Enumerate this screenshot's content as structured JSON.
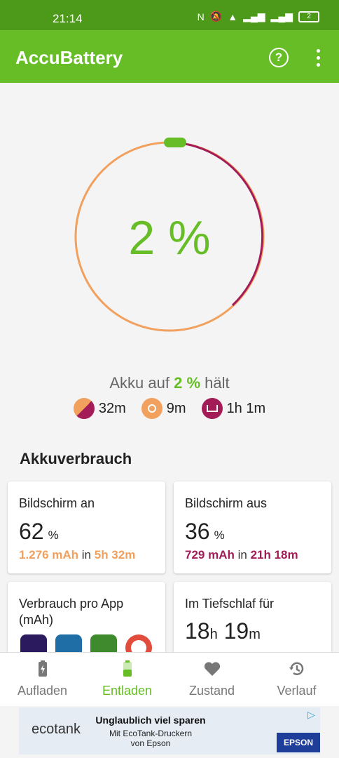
{
  "status_bar": {
    "time": "21:14",
    "battery_level": "2"
  },
  "app_bar": {
    "title": "AccuBattery",
    "help_icon": "help-circle-icon",
    "menu_icon": "more-vert-icon"
  },
  "gauge": {
    "percent_text": "2 %",
    "level": 0.02,
    "colors": {
      "orange": "#f2a05e",
      "purple": "#a31c58",
      "green": "#66bd26"
    }
  },
  "hold": {
    "prefix": "Akku auf",
    "value": "2 %",
    "suffix": "hält",
    "items": [
      {
        "icon": "mixed-usage-icon",
        "value": "32m"
      },
      {
        "icon": "sun-icon",
        "value": "9m"
      },
      {
        "icon": "sleep-icon",
        "value": "1h 1m"
      }
    ]
  },
  "usage": {
    "title": "Akkuverbrauch",
    "screen_on": {
      "label": "Bildschirm an",
      "value": "62",
      "unit": "%",
      "mah": "1.276 mAh",
      "in_word": "in",
      "duration": "5h 32m"
    },
    "screen_off": {
      "label": "Bildschirm aus",
      "value": "36",
      "unit": "%",
      "mah": "729 mAh",
      "in_word": "in",
      "duration": "21h 18m"
    },
    "per_app": {
      "label": "Verbrauch pro App (mAh)",
      "apps": [
        "firefox-icon",
        "gator-game-icon",
        "golf-game-icon",
        "chrome-icon"
      ]
    },
    "deep_sleep": {
      "label": "Im Tiefschlaf für",
      "hours": "18",
      "h_unit": "h",
      "minutes": "19",
      "m_unit": "m"
    }
  },
  "nav": [
    {
      "label": "Aufladen",
      "icon": "charging-battery-icon",
      "active": false
    },
    {
      "label": "Entladen",
      "icon": "discharging-battery-icon",
      "active": true
    },
    {
      "label": "Zustand",
      "icon": "heart-icon",
      "active": false
    },
    {
      "label": "Verlauf",
      "icon": "history-icon",
      "active": false
    }
  ],
  "ad": {
    "headline": "Unglaublich viel sparen",
    "line2": "Mit EcoTank-Druckern",
    "line3": "von Epson",
    "brand": "ecotank",
    "logo": "EPSON"
  }
}
